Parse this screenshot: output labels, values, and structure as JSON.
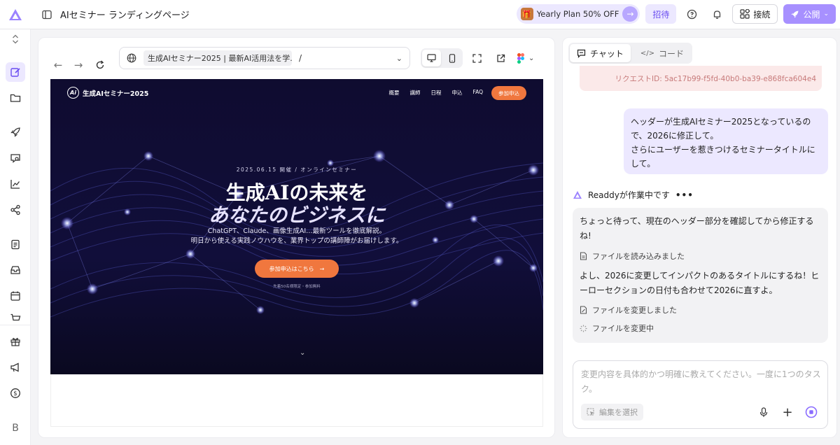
{
  "header": {
    "project_title": "AIセミナー ランディングページ",
    "promo_label": "Yearly Plan 50% OFF",
    "invite_label": "招待",
    "connect_label": "接続",
    "publish_label": "公開"
  },
  "sidebar": {
    "bottom_letter": "B"
  },
  "preview": {
    "url_title": "生成AIセミナー2025 | 最新AI活用法を学...",
    "url_path": "/"
  },
  "site": {
    "logo_text": "Ai",
    "brand": "生成AIセミナー2025",
    "nav_links": [
      "概要",
      "講師",
      "日程",
      "申込",
      "FAQ"
    ],
    "nav_cta": "参加申込",
    "hero_date": "2025.06.15 開催 / オンラインセミナー",
    "hero_title_1": "生成AIの未来を",
    "hero_title_2": "あなたのビジネスに",
    "hero_desc_1": "ChatGPT、Claude、画像生成AI…最新ツールを徹底解説。",
    "hero_desc_2": "明日から使える実践ノウハウを、業界トップの講師陣がお届けします。",
    "hero_button": "参加申込はこちら",
    "hero_note": "先着50名様限定・参加無料"
  },
  "chat": {
    "tab_chat": "チャット",
    "tab_code": "コード",
    "error_request_id": "リクエストID:  5ac17b99-f5fd-40b0-ba39-e868fca604e4",
    "user_message": "ヘッダーが生成AIセミナー2025となっているので、2026に修正して。\nさらにユーザーを惹きつけるセミナータイトルにして。",
    "agent_status": "Readdyが作業中です",
    "agent_msg_1": "ちょっと待って、現在のヘッダー部分を確認してから修正するね!",
    "file_read": "ファイルを読み込みました",
    "agent_msg_2": "よし、2026に変更してインパクトのあるタイトルにするね！ヒーローセクションの日付も合わせて2026に直すよ。",
    "file_changed": "ファイルを変更しました",
    "file_changing": "ファイルを変更中",
    "composer_placeholder": "変更内容を具体的かつ明確に教えてください。一度に1つのタスク。",
    "select_edit": "編集を選択"
  },
  "colors": {
    "accent": "#a790ff",
    "accent_light": "#ece8ff",
    "site_orange": "#f0773e",
    "hero_bg": "#0d0b2a"
  }
}
